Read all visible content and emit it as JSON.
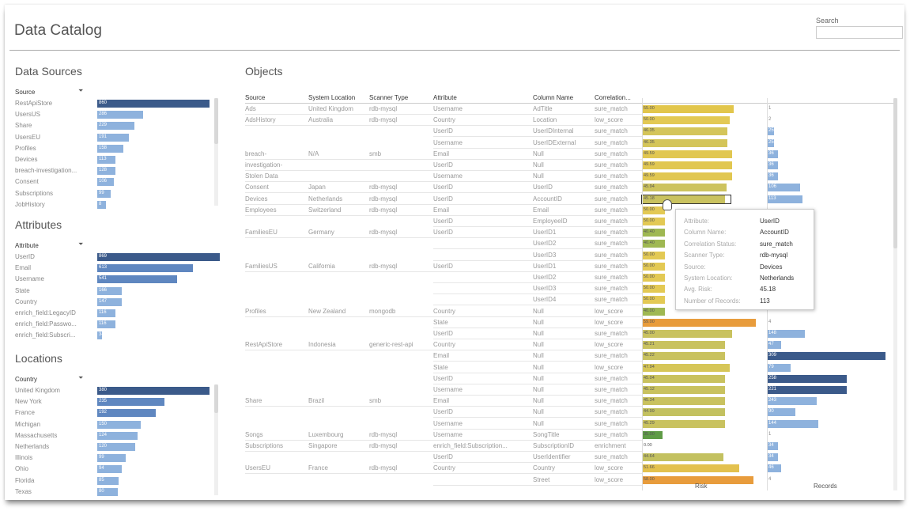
{
  "header": {
    "title": "Data Catalog",
    "search_label": "Search",
    "search_placeholder": ""
  },
  "data_sources": {
    "title": "Data Sources",
    "column": "Source",
    "rows": [
      {
        "label": "RestApiStore",
        "value": "860",
        "frac": 1.0
      },
      {
        "label": "UsersUS",
        "value": "286",
        "frac": 0.41
      },
      {
        "label": "Share",
        "value": "229",
        "frac": 0.33
      },
      {
        "label": "UsersEU",
        "value": "191",
        "frac": 0.28
      },
      {
        "label": "Profiles",
        "value": "158",
        "frac": 0.23
      },
      {
        "label": "Devices",
        "value": "113",
        "frac": 0.16
      },
      {
        "label": "breach-investigation...",
        "value": "128",
        "frac": 0.16
      },
      {
        "label": "Consent",
        "value": "106",
        "frac": 0.15
      },
      {
        "label": "Subscriptions",
        "value": "99",
        "frac": 0.12
      },
      {
        "label": "JobHistory",
        "value": "8",
        "frac": 0.08
      }
    ]
  },
  "attributes": {
    "title": "Attributes",
    "column": "Attribute",
    "rows": [
      {
        "label": "UserID",
        "value": "869",
        "frac": 1.0
      },
      {
        "label": "Email",
        "value": "613",
        "frac": 0.78
      },
      {
        "label": "Username",
        "value": "541",
        "frac": 0.65
      },
      {
        "label": "State",
        "value": "166",
        "frac": 0.2
      },
      {
        "label": "Country",
        "value": "147",
        "frac": 0.2
      },
      {
        "label": "enrich_field:LegacyID",
        "value": "116",
        "frac": 0.15
      },
      {
        "label": "enrich_field:Passwo...",
        "value": "116",
        "frac": 0.15
      },
      {
        "label": "enrich_field:Subscri...",
        "value": "34",
        "frac": 0.04
      }
    ]
  },
  "locations": {
    "title": "Locations",
    "column": "Country",
    "rows": [
      {
        "label": "United Kingdom",
        "value": "380",
        "frac": 1.0
      },
      {
        "label": "New York",
        "value": "235",
        "frac": 0.6
      },
      {
        "label": "France",
        "value": "192",
        "frac": 0.52
      },
      {
        "label": "Michigan",
        "value": "150",
        "frac": 0.39
      },
      {
        "label": "Massachusetts",
        "value": "124",
        "frac": 0.36
      },
      {
        "label": "Netherlands",
        "value": "120",
        "frac": 0.34
      },
      {
        "label": "Illinois",
        "value": "99",
        "frac": 0.25
      },
      {
        "label": "Ohio",
        "value": "94",
        "frac": 0.22
      },
      {
        "label": "Florida",
        "value": "85",
        "frac": 0.19
      },
      {
        "label": "Texas",
        "value": "80",
        "frac": 0.18
      }
    ]
  },
  "objects": {
    "title": "Objects",
    "headers": [
      "Source",
      "System Location",
      "Scanner Type",
      "Attribute",
      "Column Name",
      "Correlation..."
    ],
    "axis_risk": "Risk",
    "axis_records": "Records",
    "rows": [
      {
        "source": "Ads",
        "location": "United Kingdom",
        "scanner": "rdb-mysql",
        "attribute": "Username",
        "column": "AdTitle",
        "corr": "sure_match",
        "risk": "55.00",
        "risk_frac": 0.77,
        "risk_color": "#e2c64c",
        "rec": "1",
        "rec_frac": 0.0
      },
      {
        "source": "AdsHistory",
        "location": "Australia",
        "scanner": "rdb-mysql",
        "attribute": "Country",
        "column": "Location",
        "corr": "low_score",
        "risk": "50.00",
        "risk_frac": 0.74,
        "risk_color": "#e3c954",
        "rec": "2",
        "rec_frac": 0.0
      },
      {
        "source": "",
        "location": "",
        "scanner": "",
        "attribute": "UserID",
        "column": "UserIDInternal",
        "corr": "sure_match",
        "risk": "46.35",
        "risk_frac": 0.72,
        "risk_color": "#d4c55a",
        "rec": "25",
        "rec_frac": 0.06
      },
      {
        "source": "",
        "location": "",
        "scanner": "",
        "attribute": "Username",
        "column": "UserIDExternal",
        "corr": "sure_match",
        "risk": "46.35",
        "risk_frac": 0.72,
        "risk_color": "#d4c55a",
        "rec": "25",
        "rec_frac": 0.06
      },
      {
        "source": "breach-",
        "location": "N/A",
        "scanner": "smb",
        "attribute": "Email",
        "column": "Null",
        "corr": "sure_match",
        "risk": "49.59",
        "risk_frac": 0.76,
        "risk_color": "#e1c751",
        "rec": "36",
        "rec_frac": 0.09
      },
      {
        "source": "investigation-",
        "location": "",
        "scanner": "",
        "attribute": "UserID",
        "column": "Null",
        "corr": "sure_match",
        "risk": "49.59",
        "risk_frac": 0.76,
        "risk_color": "#e1c751",
        "rec": "36",
        "rec_frac": 0.09
      },
      {
        "source": "Stolen Data",
        "location": "",
        "scanner": "",
        "attribute": "Username",
        "column": "Null",
        "corr": "sure_match",
        "risk": "49.59",
        "risk_frac": 0.76,
        "risk_color": "#e1c751",
        "rec": "36",
        "rec_frac": 0.09
      },
      {
        "source": "Consent",
        "location": "Japan",
        "scanner": "rdb-mysql",
        "attribute": "UserID",
        "column": "UserID",
        "corr": "sure_match",
        "risk": "45.94",
        "risk_frac": 0.71,
        "risk_color": "#cdc35e",
        "rec": "106",
        "rec_frac": 0.28
      },
      {
        "source": "Devices",
        "location": "Netherlands",
        "scanner": "rdb-mysql",
        "attribute": "UserID",
        "column": "AccountID",
        "corr": "sure_match",
        "risk": "45.18",
        "risk_frac": 0.7,
        "risk_color": "#c9c25f",
        "rec": "113",
        "rec_frac": 0.3
      },
      {
        "source": "Employees",
        "location": "Switzerland",
        "scanner": "rdb-mysql",
        "attribute": "Email",
        "column": "Email",
        "corr": "sure_match",
        "risk": "50.00",
        "risk_frac": 0.19,
        "risk_color": "#e3c954",
        "rec": "",
        "rec_frac": 0.0
      },
      {
        "source": "",
        "location": "",
        "scanner": "",
        "attribute": "UserID",
        "column": "EmployeeID",
        "corr": "sure_match",
        "risk": "50.00",
        "risk_frac": 0.19,
        "risk_color": "#e3c954",
        "rec": "",
        "rec_frac": 0.0
      },
      {
        "source": "FamiliesEU",
        "location": "Germany",
        "scanner": "rdb-mysql",
        "attribute": "UserID",
        "column": "UserID1",
        "corr": "sure_match",
        "risk": "40.40",
        "risk_frac": 0.19,
        "risk_color": "#9fb852",
        "rec": "",
        "rec_frac": 0.0
      },
      {
        "source": "",
        "location": "",
        "scanner": "",
        "attribute": "",
        "column": "UserID2",
        "corr": "sure_match",
        "risk": "40.40",
        "risk_frac": 0.19,
        "risk_color": "#9fb852",
        "rec": "",
        "rec_frac": 0.0
      },
      {
        "source": "",
        "location": "",
        "scanner": "",
        "attribute": "",
        "column": "UserID3",
        "corr": "sure_match",
        "risk": "50.00",
        "risk_frac": 0.19,
        "risk_color": "#e3c954",
        "rec": "",
        "rec_frac": 0.0
      },
      {
        "source": "FamiliesUS",
        "location": "California",
        "scanner": "rdb-mysql",
        "attribute": "UserID",
        "column": "UserID1",
        "corr": "sure_match",
        "risk": "50.00",
        "risk_frac": 0.19,
        "risk_color": "#e3c954",
        "rec": "",
        "rec_frac": 0.0
      },
      {
        "source": "",
        "location": "",
        "scanner": "",
        "attribute": "",
        "column": "UserID2",
        "corr": "sure_match",
        "risk": "50.00",
        "risk_frac": 0.19,
        "risk_color": "#e3c954",
        "rec": "",
        "rec_frac": 0.0
      },
      {
        "source": "",
        "location": "",
        "scanner": "",
        "attribute": "",
        "column": "UserID3",
        "corr": "sure_match",
        "risk": "50.00",
        "risk_frac": 0.19,
        "risk_color": "#e3c954",
        "rec": "",
        "rec_frac": 0.0
      },
      {
        "source": "",
        "location": "",
        "scanner": "",
        "attribute": "",
        "column": "UserID4",
        "corr": "sure_match",
        "risk": "50.00",
        "risk_frac": 0.19,
        "risk_color": "#e3c954",
        "rec": "",
        "rec_frac": 0.0
      },
      {
        "source": "Profiles",
        "location": "New Zealand",
        "scanner": "mongodb",
        "attribute": "Country",
        "column": "Null",
        "corr": "low_score",
        "risk": "40.00",
        "risk_frac": 0.19,
        "risk_color": "#9fb852",
        "rec": "",
        "rec_frac": 0.0
      },
      {
        "source": "",
        "location": "",
        "scanner": "",
        "attribute": "State",
        "column": "Null",
        "corr": "low_score",
        "risk": "59.00",
        "risk_frac": 0.96,
        "risk_color": "#e89c3c",
        "rec": "4",
        "rec_frac": 0.0
      },
      {
        "source": "",
        "location": "",
        "scanner": "",
        "attribute": "UserID",
        "column": "Null",
        "corr": "sure_match",
        "risk": "45.00",
        "risk_frac": 0.76,
        "risk_color": "#c9c25f",
        "rec": "148",
        "rec_frac": 0.32
      },
      {
        "source": "RestApiStore",
        "location": "Indonesia",
        "scanner": "generic-rest-api",
        "attribute": "Country",
        "column": "Null",
        "corr": "low_score",
        "risk": "45.21",
        "risk_frac": 0.7,
        "risk_color": "#c9c25f",
        "rec": "47",
        "rec_frac": 0.12
      },
      {
        "source": "",
        "location": "",
        "scanner": "",
        "attribute": "Email",
        "column": "Null",
        "corr": "sure_match",
        "risk": "45.22",
        "risk_frac": 0.7,
        "risk_color": "#c9c25f",
        "rec": "309",
        "rec_frac": 1.0
      },
      {
        "source": "",
        "location": "",
        "scanner": "",
        "attribute": "State",
        "column": "Null",
        "corr": "low_score",
        "risk": "47.94",
        "risk_frac": 0.74,
        "risk_color": "#d6c658",
        "rec": "79",
        "rec_frac": 0.2
      },
      {
        "source": "",
        "location": "",
        "scanner": "",
        "attribute": "UserID",
        "column": "Null",
        "corr": "sure_match",
        "risk": "45.04",
        "risk_frac": 0.7,
        "risk_color": "#c9c25f",
        "rec": "258",
        "rec_frac": 0.67
      },
      {
        "source": "",
        "location": "",
        "scanner": "",
        "attribute": "Username",
        "column": "Null",
        "corr": "sure_match",
        "risk": "45.12",
        "risk_frac": 0.7,
        "risk_color": "#c9c25f",
        "rec": "221",
        "rec_frac": 0.67
      },
      {
        "source": "Share",
        "location": "Brazil",
        "scanner": "smb",
        "attribute": "Email",
        "column": "Null",
        "corr": "sure_match",
        "risk": "45.34",
        "risk_frac": 0.7,
        "risk_color": "#c9c25f",
        "rec": "243",
        "rec_frac": 0.42
      },
      {
        "source": "",
        "location": "",
        "scanner": "",
        "attribute": "UserID",
        "column": "Null",
        "corr": "sure_match",
        "risk": "44.99",
        "risk_frac": 0.7,
        "risk_color": "#c3c160",
        "rec": "90",
        "rec_frac": 0.24
      },
      {
        "source": "",
        "location": "",
        "scanner": "",
        "attribute": "Username",
        "column": "Null",
        "corr": "sure_match",
        "risk": "45.29",
        "risk_frac": 0.7,
        "risk_color": "#c9c25f",
        "rec": "144",
        "rec_frac": 0.43
      },
      {
        "source": "Songs",
        "location": "Luxembourg",
        "scanner": "rdb-mysql",
        "attribute": "Username",
        "column": "SongTitle",
        "corr": "sure_match",
        "risk": "35.00",
        "risk_frac": 0.17,
        "risk_color": "#5f9b47",
        "rec": "1",
        "rec_frac": 0.0
      },
      {
        "source": "Subscriptions",
        "location": "Singapore",
        "scanner": "rdb-mysql",
        "attribute": "enrich_field:Subscription...",
        "column": "SubscriptionID",
        "corr": "enrichment",
        "risk": "0.00",
        "risk_frac": 0.0,
        "risk_color": "#ffffff",
        "rec": "34",
        "rec_frac": 0.09
      },
      {
        "source": "",
        "location": "",
        "scanner": "",
        "attribute": "UserID",
        "column": "UserIdentifier",
        "corr": "sure_match",
        "risk": "44.64",
        "risk_frac": 0.69,
        "risk_color": "#c3c160",
        "rec": "34",
        "rec_frac": 0.09
      },
      {
        "source": "UsersEU",
        "location": "France",
        "scanner": "rdb-mysql",
        "attribute": "Country",
        "column": "Country",
        "corr": "low_score",
        "risk": "51.66",
        "risk_frac": 0.82,
        "risk_color": "#e3c14e",
        "rec": "46",
        "rec_frac": 0.12
      },
      {
        "source": "",
        "location": "",
        "scanner": "",
        "attribute": "",
        "column": "Street",
        "corr": "low_score",
        "risk": "58.00",
        "risk_frac": 0.94,
        "risk_color": "#e89c3c",
        "rec": "4",
        "rec_frac": 0.0
      }
    ]
  },
  "tooltip": {
    "labels": [
      "Attribute:",
      "Column Name:",
      "Correlation Status:",
      "Scanner Type:",
      "Source:",
      "System Location:",
      "Avg. Risk:",
      "Number of Records:"
    ],
    "values": [
      "UserID",
      "AccountID",
      "sure_match",
      "rdb-mysql",
      "Devices",
      "Netherlands",
      "45.18",
      "113"
    ]
  },
  "colors": {
    "bar_dark": "#3b5a8a",
    "bar_light": "#8eb2dd",
    "bar_mid": "#5f87c0"
  }
}
